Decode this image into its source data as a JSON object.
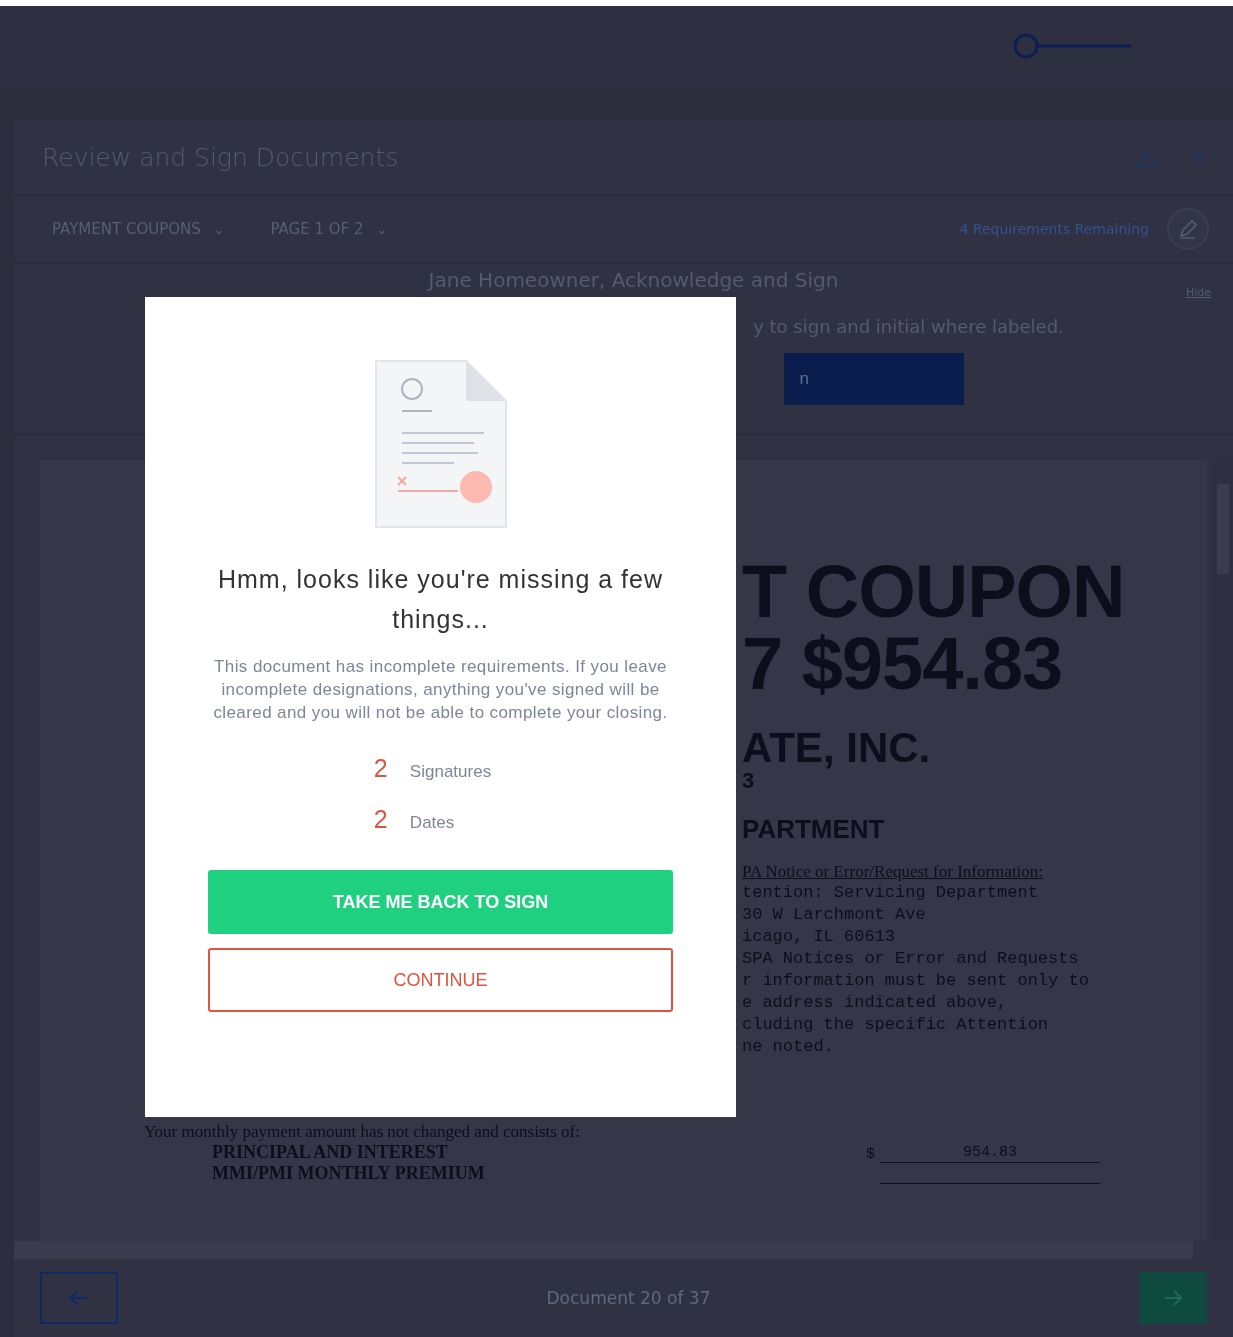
{
  "header": {
    "title": "Review and Sign Documents"
  },
  "toolbar": {
    "dropdowns": [
      {
        "label": "PAYMENT COUPONS",
        "caret": "⌄"
      },
      {
        "label": "PAGE 1 OF 2",
        "caret": "⌄"
      }
    ],
    "requirements": "4 Requirements Remaining"
  },
  "banner": {
    "title": "Jane Homeowner, Acknowledge and Sign",
    "text": "y to sign and initial where labeled.",
    "button": "n",
    "hide": "Hide"
  },
  "document": {
    "headings": [
      {
        "kind": "huge",
        "text": "T COUPON"
      },
      {
        "kind": "huge",
        "text": "7 $954.83"
      },
      {
        "kind": "large",
        "text": "ATE, INC."
      },
      {
        "kind": "small",
        "text": "3"
      },
      {
        "kind": "medium",
        "text": "PARTMENT"
      }
    ],
    "notice_title": "PA Notice or Error/Request for Information:",
    "notice_lines": [
      "tention: Servicing Department",
      "30 W Larchmont Ave",
      "icago, IL 60613",
      "SPA Notices or Error and Requests",
      "r information must be sent only to",
      "e address indicated above,",
      "cluding the specific Attention",
      "ne noted."
    ],
    "intro": "Your monthly payment amount has not changed and consists of:",
    "items": [
      {
        "label": "PRINCIPAL AND INTEREST",
        "currency": "$",
        "amount": "954.83"
      },
      {
        "label": "MMI/PMI MONTHLY PREMIUM"
      }
    ]
  },
  "footer": {
    "counter": "Document 20 of 37"
  },
  "modal": {
    "heading": "Hmm, looks like you're missing a few things...",
    "body": "This document has incomplete requirements. If you leave incomplete designations, anything you've signed will be cleared and you will not be able to complete your closing.",
    "missing": [
      {
        "count": "2",
        "label": "Signatures"
      },
      {
        "count": "2",
        "label": "Dates"
      }
    ],
    "buttons": [
      {
        "kind": "primary",
        "label": "TAKE ME BACK TO SIGN"
      },
      {
        "kind": "secondary",
        "label": "CONTINUE"
      }
    ]
  }
}
